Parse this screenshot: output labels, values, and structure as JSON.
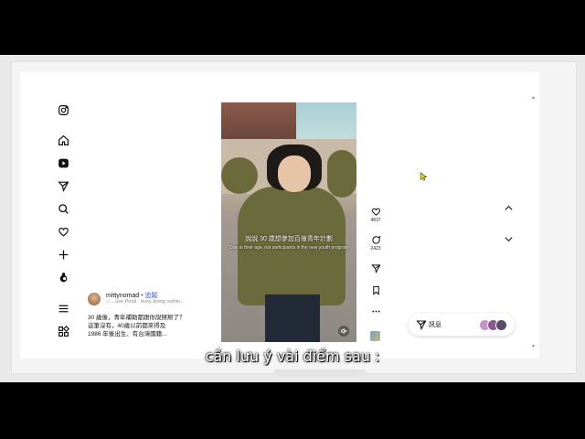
{
  "sidebar": {
    "icons": [
      "instagram-icon",
      "home-icon",
      "reels-icon",
      "send-icon",
      "search-icon",
      "heart-icon",
      "plus-icon",
      "threads-icon",
      "menu-icon",
      "grid-icon"
    ]
  },
  "video": {
    "caption_zh": "說說 30 歲想參加百億青年計劃",
    "caption_en": "Due to their age, not participants in the new youth program"
  },
  "actions": {
    "like_count": "4837",
    "comment_count": "2423"
  },
  "post": {
    "username": "mittynomad",
    "follow_label": "• 追蹤",
    "music": "♫ ...use Petal · busy doing nothin...",
    "description_lines": [
      "30 歲後，青年補助都跟你說掰掰了？",
      "這筆沒有，40歲以前都來得及",
      "1986 年後出生、有台灣國籍..."
    ]
  },
  "messages": {
    "label": "訊息",
    "avatar_colors": [
      "#c98fd0",
      "#8a5a8f",
      "#5a4a6a"
    ]
  },
  "subtitle": "cần lưu ý vài điểm sau :",
  "colors": {
    "accent": "#4a5bdc",
    "background": "#ffffff"
  }
}
